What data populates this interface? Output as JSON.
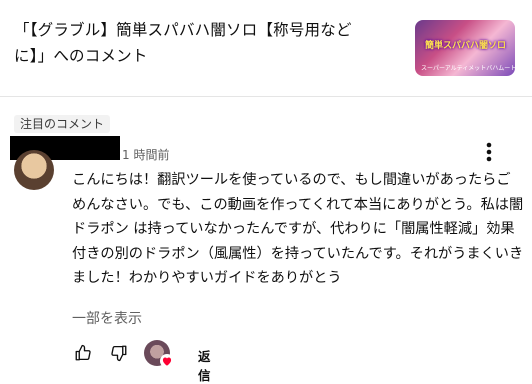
{
  "video": {
    "title": "「【グラブル】簡単スパバハ闇ソロ【称号用などに】」へのコメント",
    "thumbnail_text": "簡単スパバハ闇ソロ",
    "thumbnail_subtext": "スーパーアルティメットバハムート"
  },
  "comment": {
    "badge": "注目のコメント",
    "timestamp": "1 時間前",
    "text": "こんにちは！翻訳ツールを使っているので、もし間違いがあったらごめんなさい。でも、この動画を作ってくれて本当にありがとう。私は闇ドラポン は持っていなかったんですが、代わりに「闇属性軽減」効果付きの別のドラポン（風属性）を持っていたんです。それがうまくいきました！わかりやすいガイドをありがとう",
    "show_more": "一部を表示",
    "reply_label": "返信"
  },
  "icons": {
    "like": "thumbs-up-icon",
    "dislike": "thumbs-down-icon",
    "more": "more-vertical-icon",
    "heart": "heart-icon"
  },
  "colors": {
    "heart": "#ff0033",
    "secondary_text": "#606060"
  }
}
